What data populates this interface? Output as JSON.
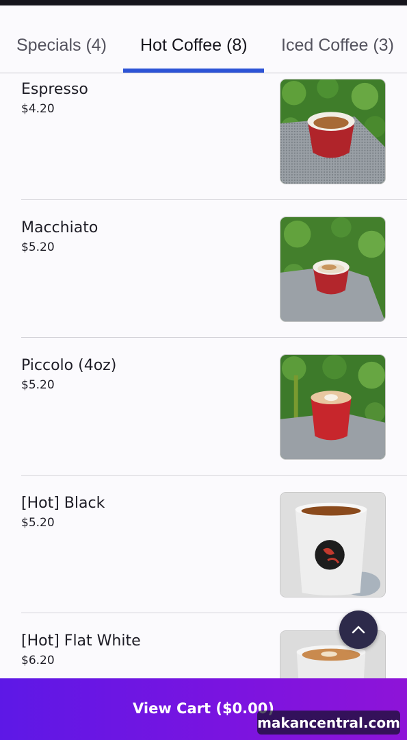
{
  "tabs": [
    {
      "label": "Specials (4)"
    },
    {
      "label": "Hot Coffee (8)"
    },
    {
      "label": "Iced Coffee (3)"
    }
  ],
  "active_tab": "Hot Coffee (8)",
  "menu_items": [
    {
      "name": "Espresso",
      "price": "$4.20"
    },
    {
      "name": "Macchiato",
      "price": "$5.20"
    },
    {
      "name": "Piccolo (4oz)",
      "price": "$5.20"
    },
    {
      "name": "[Hot] Black",
      "price": "$5.20"
    },
    {
      "name": "[Hot] Flat White",
      "price": "$6.20"
    }
  ],
  "scroll_top_button": {
    "icon": "chevron-up-icon"
  },
  "cart": {
    "label": "View Cart ($0.00)"
  },
  "watermark": "makancentral.com",
  "colors": {
    "active_tab_underline": "#2c53d6",
    "cart_gradient_start": "#5d18e6",
    "cart_gradient_end": "#8e14d8",
    "fab_background": "#2d2a4a"
  }
}
